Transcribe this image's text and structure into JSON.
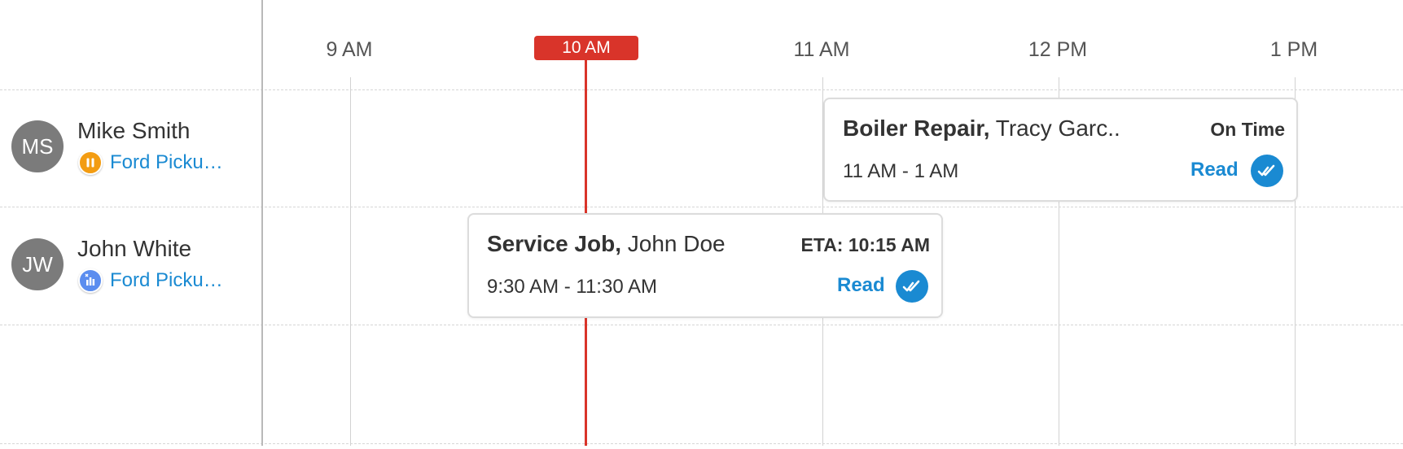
{
  "timeline": {
    "ticks": [
      "9 AM",
      "11 AM",
      "12 PM",
      "1 PM"
    ],
    "now_label": "10 AM"
  },
  "technicians": [
    {
      "initials": "MS",
      "name": "Mike Smith",
      "vehicle": "Ford Picku…",
      "vehicle_status_icon": "pause-icon",
      "vehicle_status_color": "#f39c12"
    },
    {
      "initials": "JW",
      "name": "John White",
      "vehicle": "Ford Picku…",
      "vehicle_status_icon": "idle-chart-icon",
      "vehicle_status_color": "#5b8def"
    }
  ],
  "jobs": [
    {
      "job_type": "Boiler Repair,",
      "customer": "Tracy Garc..",
      "status": "On Time",
      "time_range": "11 AM - 1 AM",
      "read_label": "Read",
      "read_icon": "double-check-icon"
    },
    {
      "job_type": "Service Job,",
      "customer": "John Doe",
      "status": "ETA: 10:15 AM",
      "time_range": "9:30 AM - 11:30 AM",
      "read_label": "Read",
      "read_icon": "double-check-icon"
    }
  ],
  "colors": {
    "accent": "#1a8ad2",
    "now_indicator": "#d9342a",
    "avatar": "#7b7b7b"
  }
}
